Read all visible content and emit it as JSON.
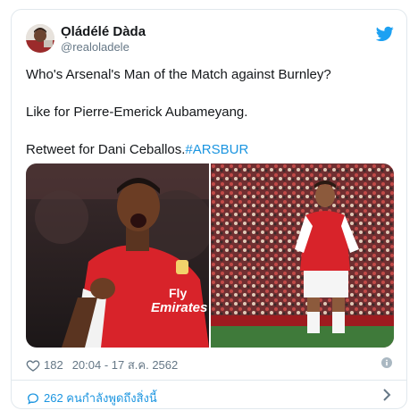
{
  "tweet": {
    "display_name": "Ọládélé Dàda",
    "handle": "@realoladele",
    "paragraph_1": "Who's Arsenal's Man of the Match against Burnley?",
    "paragraph_2": "Like for Pierre-Emerick Aubameyang.",
    "paragraph_3": "Retweet for Dani Ceballos.",
    "hashtag": "#ARSBUR",
    "likes": "182",
    "timestamp": "20:04 - 17 ส.ค. 2562",
    "talking_label": "262 คนกำลังพูดถึงสิ่งนี้"
  },
  "media": {
    "left_jersey_text_1": "Fly",
    "left_jersey_text_2": "Emirates"
  },
  "icons": {
    "brand": "twitter-bird-icon",
    "like": "heart-icon",
    "info": "info-icon",
    "reply": "speech-bubble-icon",
    "more": "chevron-right-icon"
  },
  "colors": {
    "accent": "#1b95e0",
    "muted": "#657786",
    "border": "#e1e8ed",
    "arsenal_red": "#d8232a"
  }
}
